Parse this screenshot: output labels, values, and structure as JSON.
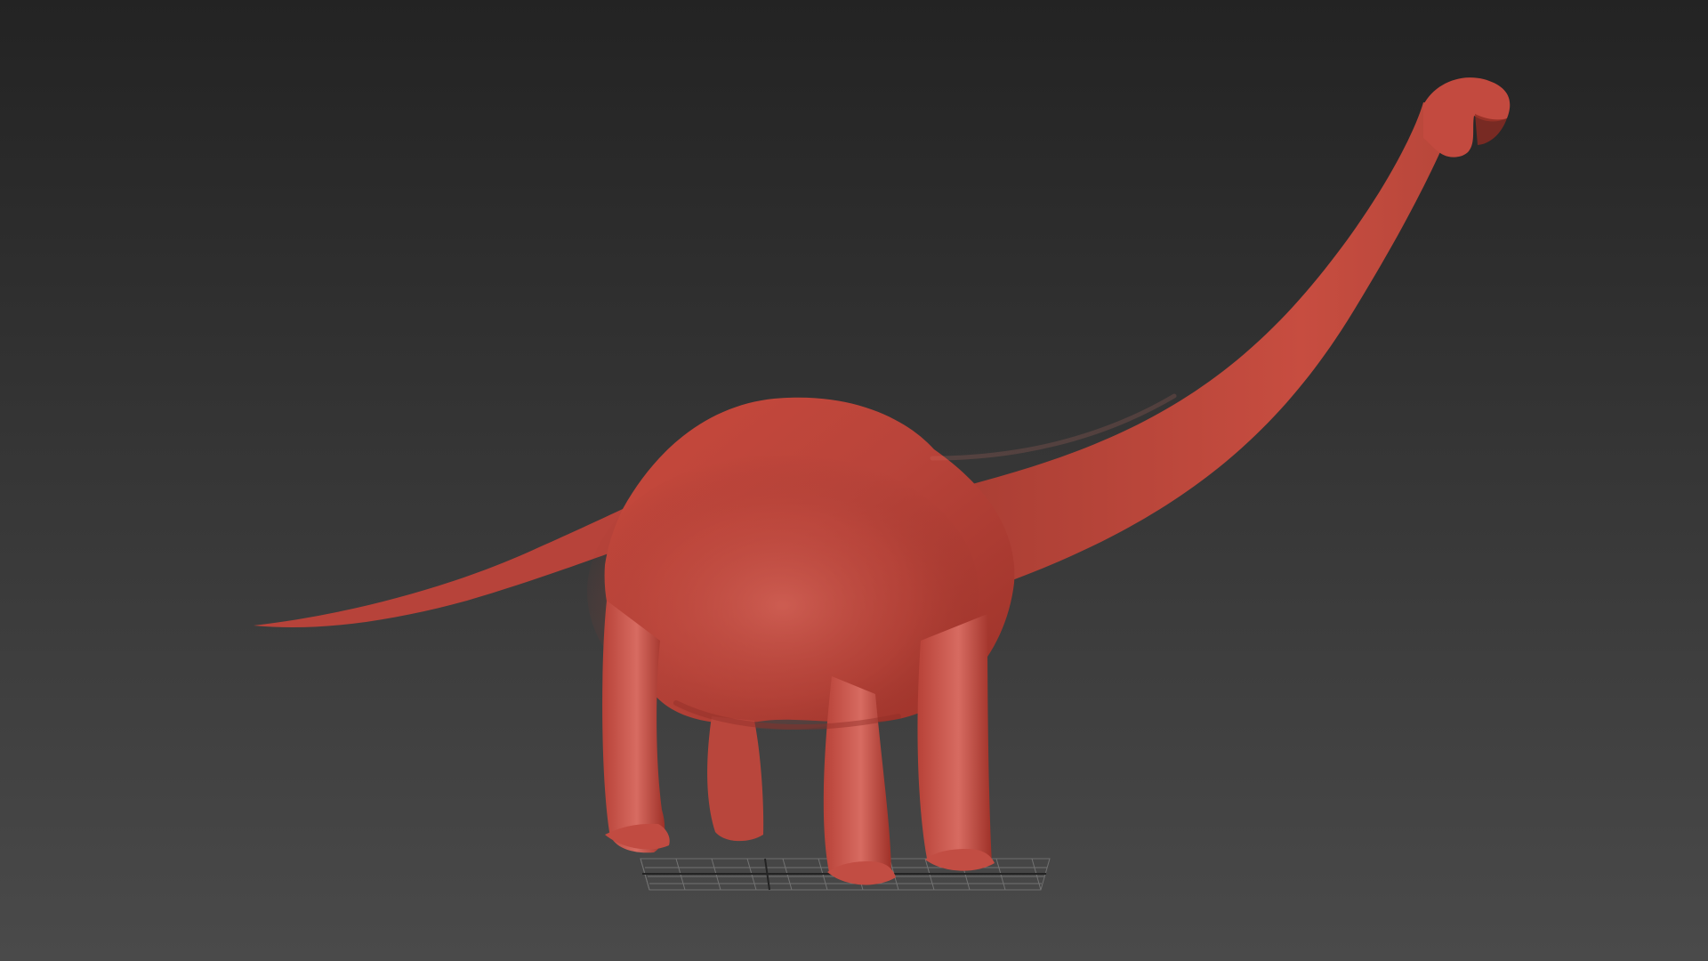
{
  "viewport": {
    "background_top_color": "#232323",
    "background_bottom_color": "#4a4a4a",
    "model": {
      "name": "sauropod-sculpt",
      "kind": "3d-model",
      "base_color": "#c8493c",
      "highlight_color": "#d85f52",
      "shadow_color": "#8e2f27"
    },
    "grid": {
      "line_color": "#7a7a7a",
      "axis_color": "#1e1e1e"
    }
  }
}
